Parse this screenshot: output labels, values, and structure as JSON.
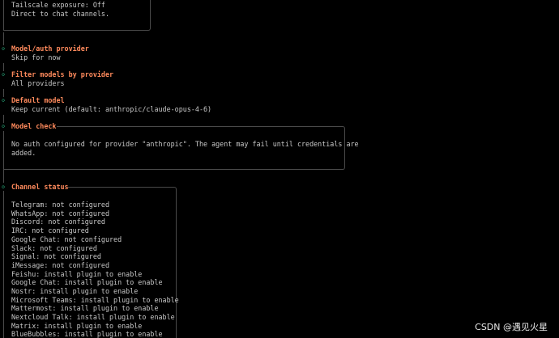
{
  "top_box": {
    "lines": [
      "Tailscale exposure: Off",
      "Direct to chat channels."
    ]
  },
  "steps": [
    {
      "title": "Model/auth provider",
      "value": "Skip for now"
    },
    {
      "title": "Filter models by provider",
      "value": "All providers"
    },
    {
      "title": "Default model",
      "value": "Keep current (default: anthropic/claude-opus-4-6)"
    }
  ],
  "model_check": {
    "title": "Model check",
    "lines": [
      "No auth configured for provider \"anthropic\". The agent may fail until credentials are",
      "added."
    ]
  },
  "channel_status": {
    "title": "Channel status",
    "items": [
      "Telegram: not configured",
      "WhatsApp: not configured",
      "Discord: not configured",
      "IRC: not configured",
      "Google Chat: not configured",
      "Slack: not configured",
      "Signal: not configured",
      "iMessage: not configured",
      "Feishu: install plugin to enable",
      "Google Chat: install plugin to enable",
      "Nostr: install plugin to enable",
      "Microsoft Teams: install plugin to enable",
      "Mattermost: install plugin to enable",
      "Nextcloud Talk: install plugin to enable",
      "Matrix: install plugin to enable",
      "BlueBubbles: install plugin to enable"
    ]
  },
  "watermark": "CSDN @遇见火星",
  "colors": {
    "heading": "#ff8a5c",
    "diamond": "#2bbf8a",
    "text": "#c8c8c8",
    "border": "#4a4a4a"
  }
}
